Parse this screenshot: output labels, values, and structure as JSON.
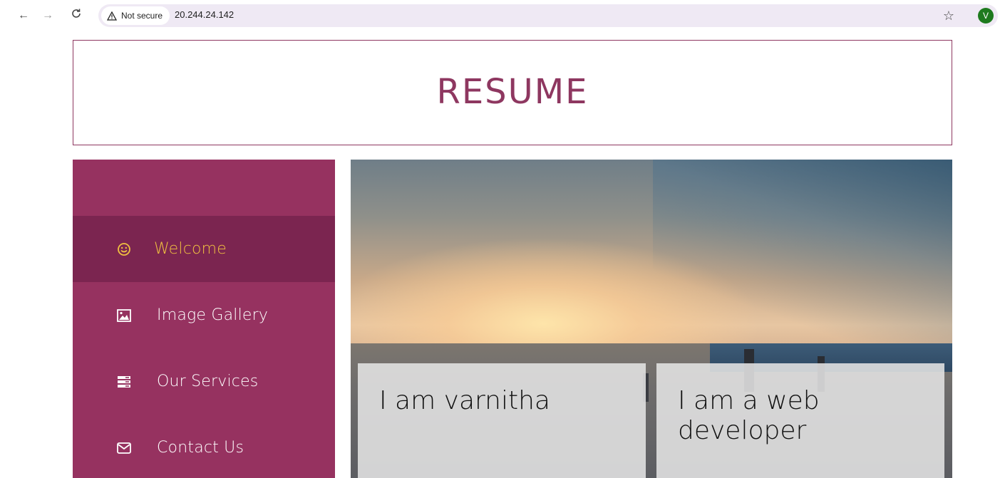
{
  "browser": {
    "security_label": "Not secure",
    "url": "20.244.24.142",
    "avatar_letter": "V",
    "icons": [
      "back-icon",
      "forward-icon",
      "reload-icon",
      "warning-icon",
      "star-icon"
    ]
  },
  "header": {
    "title": "RESUME"
  },
  "sidebar": {
    "items": [
      {
        "label": "Welcome",
        "icon": "smiley-icon",
        "active": true
      },
      {
        "label": "Image Gallery",
        "icon": "image-icon",
        "active": false
      },
      {
        "label": "Our Services",
        "icon": "services-icon",
        "active": false
      },
      {
        "label": "Contact Us",
        "icon": "envelope-icon",
        "active": false
      }
    ]
  },
  "hero": {
    "cards": [
      {
        "text": "I am varnitha"
      },
      {
        "text": "I am a web developer"
      }
    ]
  },
  "colors": {
    "brand": "#963260",
    "active_item": "#7b2550",
    "active_label": "#f0c040",
    "title": "#8e3760"
  }
}
